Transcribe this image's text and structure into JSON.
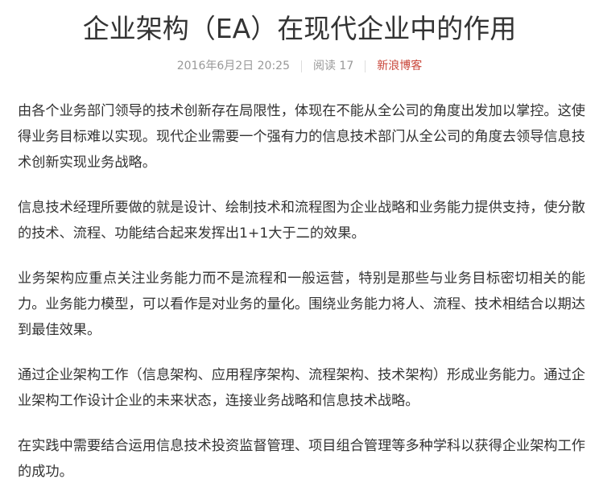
{
  "article": {
    "title": "企业架构（EA）在现代企业中的作用",
    "meta": {
      "date": "2016年6月2日 20:25",
      "read_label": "阅读 17",
      "source": "新浪博客"
    },
    "paragraphs": [
      "由各个业务部门领导的技术创新存在局限性，体现在不能从全公司的角度出发加以掌控。这使得业务目标难以实现。现代企业需要一个强有力的信息技术部门从全公司的角度去领导信息技术创新实现业务战略。",
      "信息技术经理所要做的就是设计、绘制技术和流程图为企业战略和业务能力提供支持，使分散的技术、流程、功能结合起来发挥出1+1大于二的效果。",
      "业务架构应重点关注业务能力而不是流程和一般运营，特别是那些与业务目标密切相关的能力。业务能力模型，可以看作是对业务的量化。围绕业务能力将人、流程、技术相结合以期达到最佳效果。",
      "通过企业架构工作（信息架构、应用程序架构、流程架构、技术架构）形成业务能力。通过企业架构工作设计企业的未来状态，连接业务战略和信息技术战略。",
      "在实践中需要结合运用信息技术投资监督管理、项目组合管理等多种学科以获得企业架构工作的成功。"
    ]
  },
  "colors": {
    "text": "#333333",
    "meta": "#999999",
    "source_link": "#c9463a",
    "separator": "#dddddd"
  }
}
